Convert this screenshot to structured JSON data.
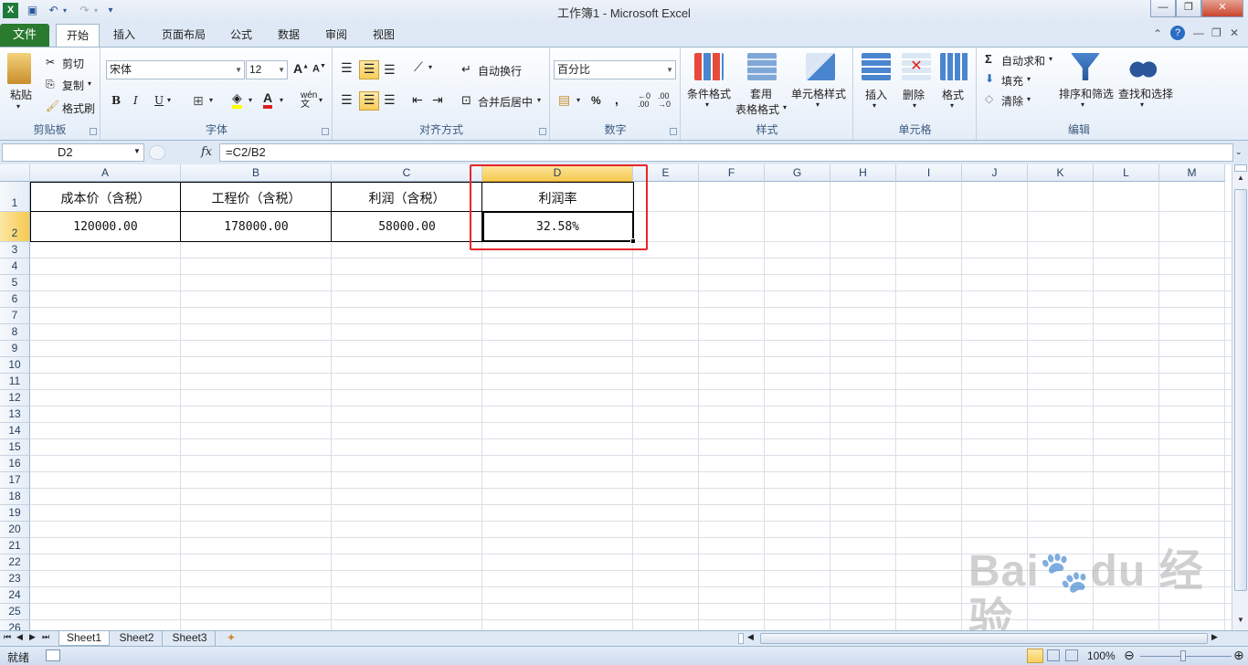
{
  "app": {
    "title": "工作簿1 - Microsoft Excel"
  },
  "tabs": [
    "文件",
    "开始",
    "插入",
    "页面布局",
    "公式",
    "数据",
    "审阅",
    "视图"
  ],
  "ribbon": {
    "clipboard": {
      "paste": "粘贴",
      "cut": "剪切",
      "copy": "复制",
      "format_painter": "格式刷",
      "group": "剪贴板"
    },
    "font": {
      "name": "宋体",
      "size": "12",
      "bold": "B",
      "italic": "I",
      "underline": "U",
      "group": "字体"
    },
    "alignment": {
      "wrap": "自动换行",
      "merge": "合并后居中",
      "group": "对齐方式"
    },
    "number": {
      "format": "百分比",
      "percent": "%",
      "comma": ",",
      "group": "数字"
    },
    "styles": {
      "conditional": "条件格式",
      "table_line1": "套用",
      "table_line2": "表格格式",
      "cell_styles": "单元格样式",
      "group": "样式"
    },
    "cells": {
      "insert": "插入",
      "delete": "删除",
      "format": "格式",
      "group": "单元格"
    },
    "editing": {
      "autosum": "自动求和",
      "fill": "填充",
      "clear": "清除",
      "sort": "排序和筛选",
      "find": "查找和选择",
      "group": "编辑"
    }
  },
  "formula_bar": {
    "name_box": "D2",
    "fx": "fx",
    "formula": "=C2/B2"
  },
  "columns": [
    "A",
    "B",
    "C",
    "D",
    "E",
    "F",
    "G",
    "H",
    "I",
    "J",
    "K",
    "L",
    "M"
  ],
  "rows": [
    "1",
    "2",
    "3",
    "4",
    "5",
    "6",
    "7",
    "8",
    "9",
    "10",
    "11",
    "12",
    "13",
    "14",
    "15",
    "16",
    "17",
    "18",
    "19",
    "20",
    "21",
    "22",
    "23",
    "24",
    "25",
    "26"
  ],
  "cells": {
    "A1": "成本价（含税）",
    "B1": "工程价（含税）",
    "C1": "利润（含税）",
    "D1": "利润率",
    "A2": "120000.00",
    "B2": "178000.00",
    "C2": "58000.00",
    "D2": "32.58%"
  },
  "selected_cell": "D2",
  "sheets": [
    "Sheet1",
    "Sheet2",
    "Sheet3"
  ],
  "status": {
    "ready": "就绪",
    "zoom": "100%"
  },
  "watermark": "Baidu经验 jingyan.baidu.com",
  "colors": {
    "file_tab": "#2a7a2f",
    "highlight": "#e8262a",
    "selected_header": "#f6c94f"
  }
}
